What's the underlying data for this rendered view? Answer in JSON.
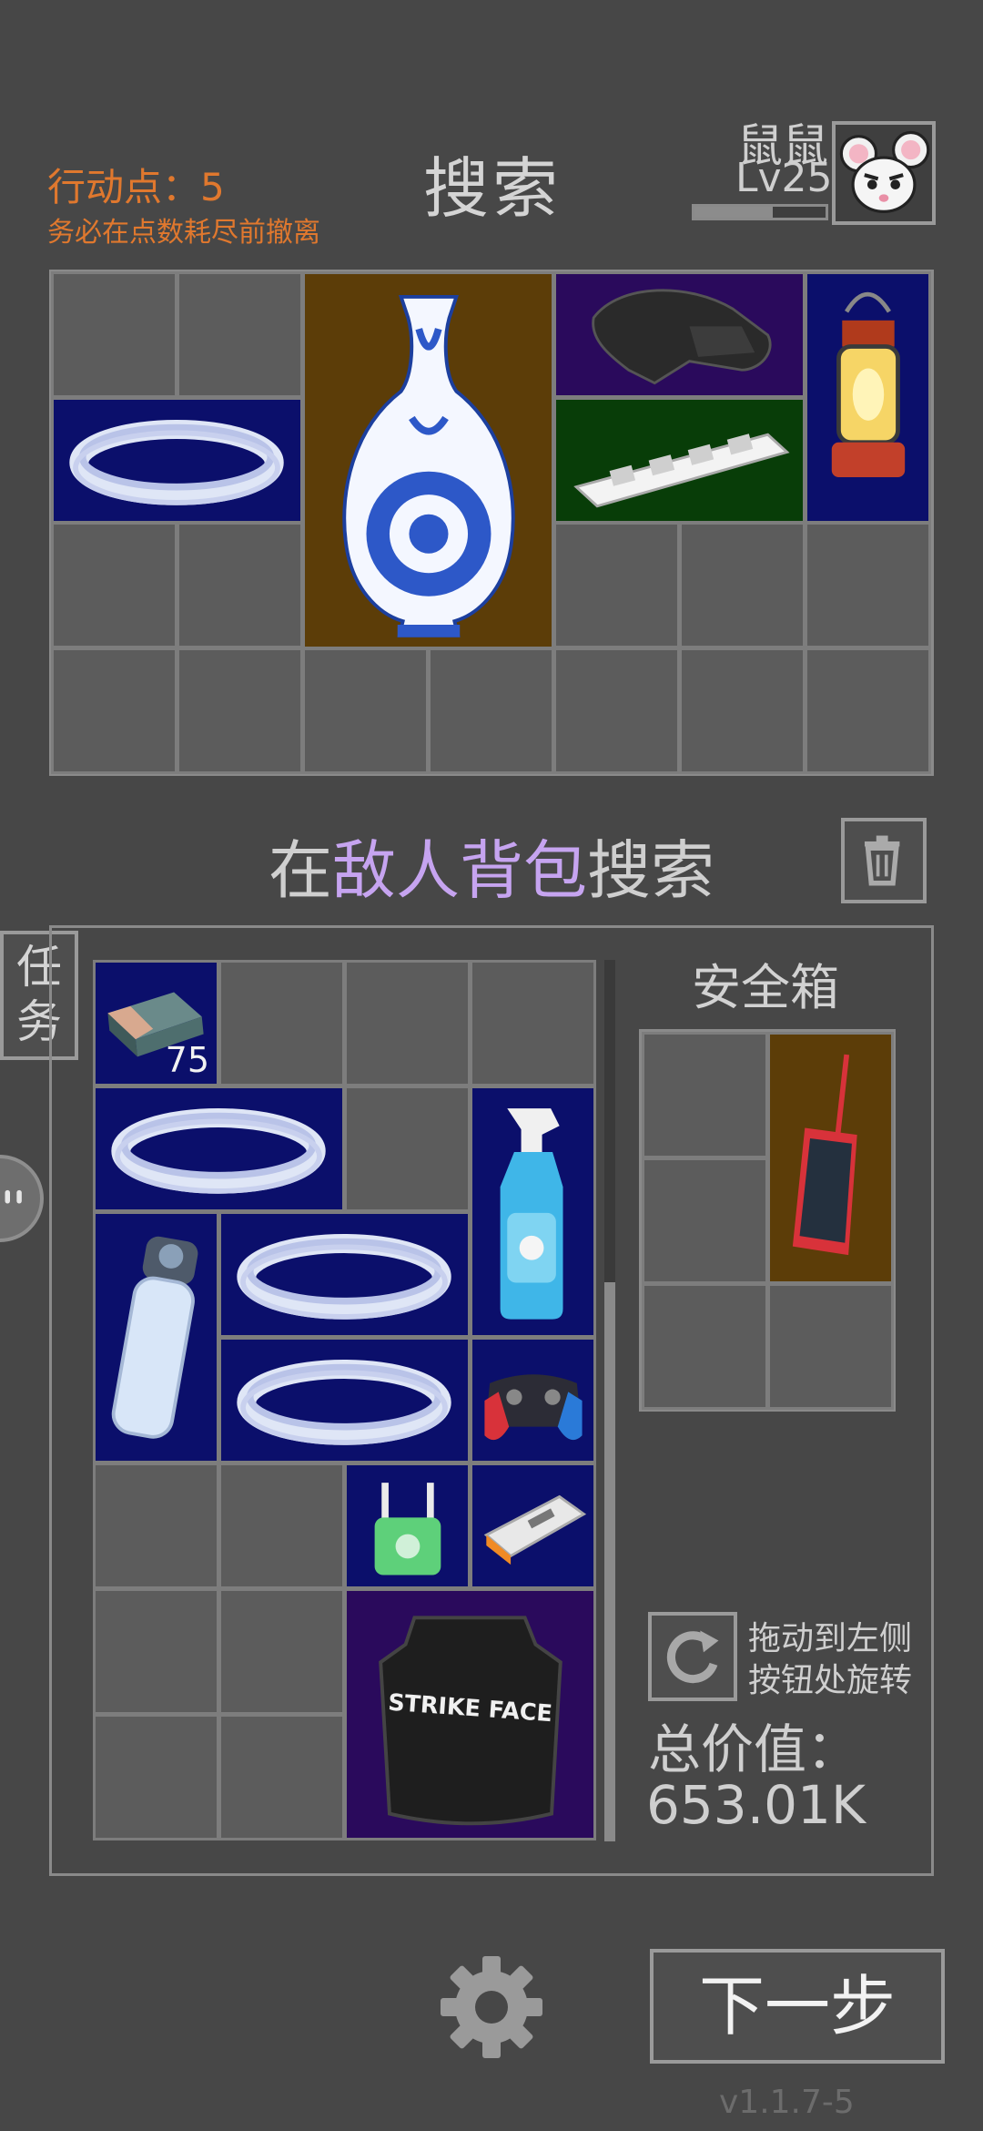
{
  "header": {
    "action_points": "行动点：5",
    "warning": "务必在点数耗尽前撤离",
    "title": "搜索",
    "player_name": "鼠鼠",
    "player_level": "Lv25",
    "xp_progress": 0.6
  },
  "search_title": {
    "prefix": "在",
    "highlight": "敌人背包",
    "suffix": "搜索"
  },
  "side_tab": {
    "label_line1": "任",
    "label_line2": "务"
  },
  "backpack": {
    "stack_count": "75"
  },
  "safebox": {
    "title": "安全箱"
  },
  "rotate_hint": {
    "line1": "拖动到左侧",
    "line2": "按钮处旋转"
  },
  "total_value": {
    "label": "总价值：",
    "value": "653.01K"
  },
  "next_button": {
    "label": "下一步"
  },
  "version": "v1.1.7-5",
  "items_icon_names": [
    "vase-icon",
    "helmet-icon",
    "power-strip-icon",
    "lantern-icon",
    "rope-coil-icon",
    "gum-pack-icon",
    "spray-bottle-icon",
    "water-bottle-icon",
    "gamepad-icon",
    "router-icon",
    "power-bank-icon",
    "armor-plate-icon",
    "smartphone-icon"
  ],
  "text": [
    "STRIKE FACE"
  ]
}
